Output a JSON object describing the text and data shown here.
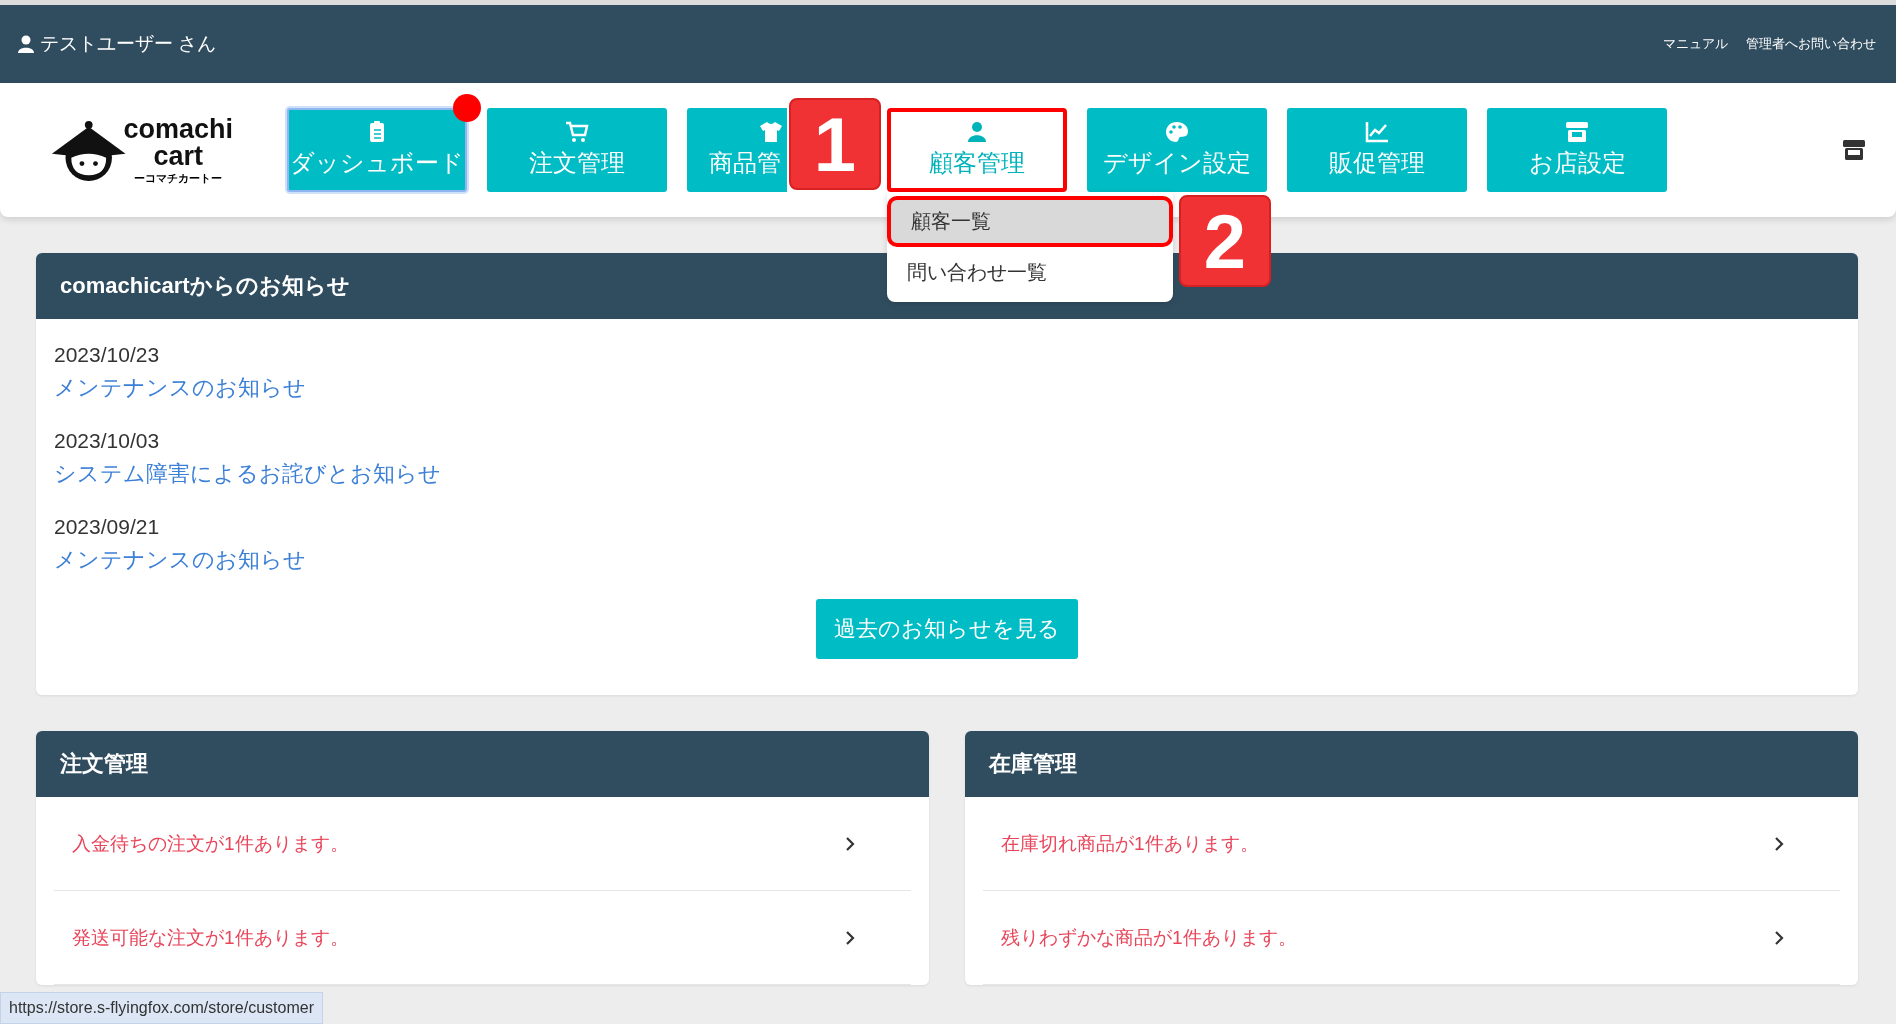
{
  "top_bar": {
    "user": "テストユーザー さん",
    "links": [
      "マニュアル",
      "管理者へお問い合わせ"
    ]
  },
  "logo": {
    "name_line1": "comachi",
    "name_line2": "cart",
    "reading": "ーコマチカートー"
  },
  "nav": [
    {
      "label": "ダッシュボード",
      "kind": "clipboard",
      "selected": false,
      "notification": true
    },
    {
      "label": "注文管理",
      "kind": "cart",
      "selected": false,
      "notification": false
    },
    {
      "label": "商品管",
      "kind": "shirt",
      "selected": false,
      "notification": false
    },
    {
      "label": "顧客管理",
      "kind": "person",
      "selected": true,
      "notification": false
    },
    {
      "label": "デザイン設定",
      "kind": "palette",
      "selected": false,
      "notification": false
    },
    {
      "label": "販促管理",
      "kind": "chart",
      "selected": false,
      "notification": false
    },
    {
      "label": "お店設定",
      "kind": "store",
      "selected": false,
      "notification": false
    }
  ],
  "dropdown": [
    {
      "label": "顧客一覧",
      "selected": true
    },
    {
      "label": "問い合わせ一覧",
      "selected": false
    }
  ],
  "annotations": [
    "1",
    "2"
  ],
  "notices": {
    "title": "comachicartからのお知らせ",
    "items": [
      {
        "date": "2023/10/23",
        "link": "メンテナンスのお知らせ"
      },
      {
        "date": "2023/10/03",
        "link": "システム障害によるお詫びとお知らせ"
      },
      {
        "date": "2023/09/21",
        "link": "メンテナンスのお知らせ"
      }
    ],
    "button": "過去のお知らせを見る"
  },
  "panels": [
    {
      "title": "注文管理",
      "rows": [
        "入金待ちの注文が1件あります。",
        "発送可能な注文が1件あります。"
      ]
    },
    {
      "title": "在庫管理",
      "rows": [
        "在庫切れ商品が1件あります。",
        "残りわずかな商品が1件あります。"
      ]
    }
  ],
  "status_url": "https://store.s-flyingfox.com/store/customer"
}
